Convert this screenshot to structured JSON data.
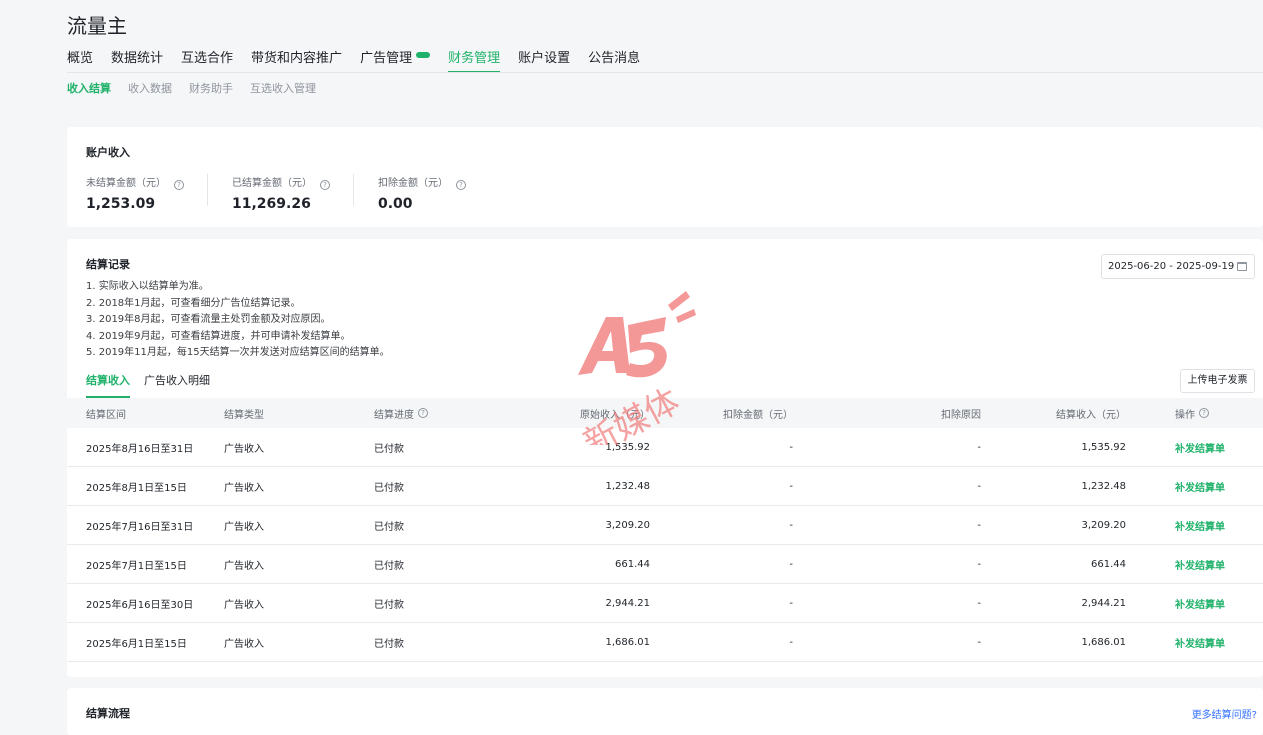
{
  "app_title": "流量主",
  "nav": [
    {
      "label": "概览",
      "active": false
    },
    {
      "label": "数据统计",
      "active": false
    },
    {
      "label": "互选合作",
      "active": false
    },
    {
      "label": "带货和内容推广",
      "active": false
    },
    {
      "label": "广告管理",
      "active": false,
      "badge": "new"
    },
    {
      "label": "财务管理",
      "active": true
    },
    {
      "label": "账户设置",
      "active": false
    },
    {
      "label": "公告消息",
      "active": false
    }
  ],
  "subnav": [
    {
      "label": "收入结算",
      "active": true
    },
    {
      "label": "收入数据",
      "active": false
    },
    {
      "label": "财务助手",
      "active": false
    },
    {
      "label": "互选收入管理",
      "active": false
    }
  ],
  "account": {
    "title": "账户收入",
    "stats": [
      {
        "label": "未结算金额（元）",
        "value": "1,253.09"
      },
      {
        "label": "已结算金额（元）",
        "value": "11,269.26"
      },
      {
        "label": "扣除金额（元）",
        "value": "0.00"
      }
    ]
  },
  "records": {
    "title": "结算记录",
    "date_range": "2025-06-20 - 2025-09-19",
    "notes": [
      "1. 实际收入以结算单为准。",
      "2. 2018年1月起，可查看细分广告位结算记录。",
      "3. 2019年8月起，可查看流量主处罚金额及对应原因。",
      "4. 2019年9月起，可查看结算进度，并可申请补发结算单。",
      "5. 2019年11月起，每15天结算一次并发送对应结算区间的结算单。"
    ],
    "tabs": [
      {
        "label": "结算收入",
        "active": true
      },
      {
        "label": "广告收入明细",
        "active": false
      }
    ],
    "upload_label": "上传电子发票",
    "columns": [
      "结算区间",
      "结算类型",
      "结算进度",
      "原始收入（元）",
      "扣除金额（元）",
      "扣除原因",
      "结算收入（元）",
      "操作"
    ],
    "rows": [
      {
        "period": "2025年8月16日至31日",
        "type": "广告收入",
        "status": "已付款",
        "original": "1,535.92",
        "deduction": "-",
        "reason": "-",
        "settled": "1,535.92",
        "action": "补发结算单"
      },
      {
        "period": "2025年8月1日至15日",
        "type": "广告收入",
        "status": "已付款",
        "original": "1,232.48",
        "deduction": "-",
        "reason": "-",
        "settled": "1,232.48",
        "action": "补发结算单"
      },
      {
        "period": "2025年7月16日至31日",
        "type": "广告收入",
        "status": "已付款",
        "original": "3,209.20",
        "deduction": "-",
        "reason": "-",
        "settled": "3,209.20",
        "action": "补发结算单"
      },
      {
        "period": "2025年7月1日至15日",
        "type": "广告收入",
        "status": "已付款",
        "original": "661.44",
        "deduction": "-",
        "reason": "-",
        "settled": "661.44",
        "action": "补发结算单"
      },
      {
        "period": "2025年6月16日至30日",
        "type": "广告收入",
        "status": "已付款",
        "original": "2,944.21",
        "deduction": "-",
        "reason": "-",
        "settled": "2,944.21",
        "action": "补发结算单"
      },
      {
        "period": "2025年6月1日至15日",
        "type": "广告收入",
        "status": "已付款",
        "original": "1,686.01",
        "deduction": "-",
        "reason": "-",
        "settled": "1,686.01",
        "action": "补发结算单"
      }
    ]
  },
  "flow": {
    "title": "结算流程",
    "more_link": "更多结算问题?"
  },
  "watermark": {
    "logo_text": "A5",
    "caption": "新媒体",
    "color": "#f27b7b"
  },
  "colors": {
    "accent": "#20b26b",
    "link_blue": "#3370ff"
  }
}
